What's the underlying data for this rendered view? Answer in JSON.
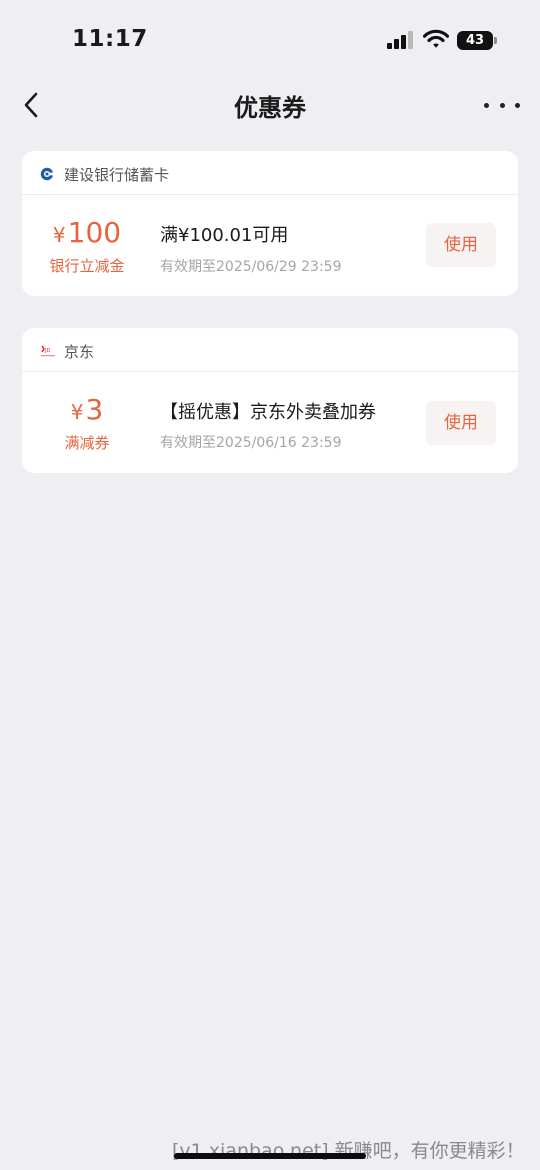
{
  "status_bar": {
    "time": "11:17",
    "battery_level": "43",
    "signal_icon": "cellular-signal-icon",
    "wifi_icon": "wifi-icon",
    "battery_icon": "battery-icon"
  },
  "nav": {
    "title": "优惠券",
    "back_icon": "chevron-left-icon",
    "more_icon": "more-horizontal-icon"
  },
  "coupons": [
    {
      "merchant_name": "建设银行储蓄卡",
      "merchant_icon": "ccb-bank-logo-icon",
      "currency": "¥",
      "amount": "100",
      "amount_label": "银行立减金",
      "title": "满¥100.01可用",
      "expiry": "有效期至2025/06/29 23:59",
      "use_label": "使用"
    },
    {
      "merchant_name": "京东",
      "merchant_icon": "jd-logo-icon",
      "currency": "¥",
      "amount": "3",
      "amount_label": "满减券",
      "title": "【摇优惠】京东外卖叠加券",
      "expiry": "有效期至2025/06/16 23:59",
      "use_label": "使用"
    }
  ],
  "colors": {
    "accent": "#e4653f",
    "background": "#efeef3",
    "card": "#ffffff"
  },
  "watermark": "[v1.xianbao.net] 新赚吧，有你更精彩！"
}
